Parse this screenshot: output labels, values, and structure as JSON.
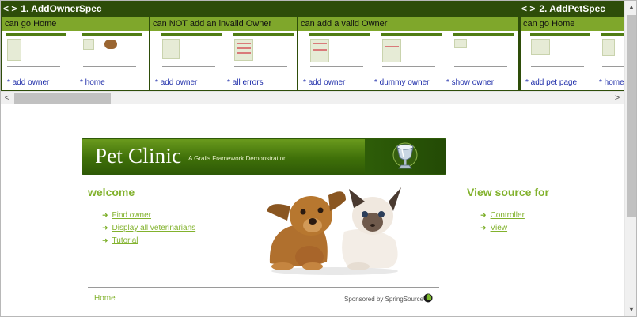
{
  "specs": [
    {
      "arrows": "< >",
      "title": "1. AddOwnerSpec",
      "features": [
        {
          "name": "can go Home",
          "links": [
            "* add owner",
            "* home"
          ]
        },
        {
          "name": "can NOT add an invalid Owner",
          "links": [
            "* add owner",
            "* all errors"
          ]
        },
        {
          "name": "can add a valid Owner",
          "links": [
            "* add owner",
            "* dummy owner",
            "* show owner"
          ]
        }
      ]
    },
    {
      "arrows": "< >",
      "title": "2. AddPetSpec",
      "features": [
        {
          "name": "can go Home",
          "links": [
            "* add pet page",
            "* home"
          ]
        }
      ]
    }
  ],
  "scroll": {
    "left_arrow": "<",
    "right_arrow": ">",
    "up_arrow": "▲",
    "down_arrow": "▼"
  },
  "site": {
    "title": "Pet Clinic",
    "subtitle": "A Grails Framework Demonstration",
    "welcome_heading": "welcome",
    "welcome_links": [
      "Find owner",
      "Display all veterinarians",
      "Tutorial"
    ],
    "source_heading": "View source for",
    "source_links": [
      "Controller",
      "View"
    ],
    "footer_home": "Home",
    "footer_sponsor": "Sponsored by SpringSource",
    "bullet_icon": "arrow-right-icon"
  },
  "colors": {
    "strip_bg": "#2e4d09",
    "feature_head": "#7fa72b",
    "link_blue": "#1b2aa8",
    "site_green": "#82b22d"
  }
}
